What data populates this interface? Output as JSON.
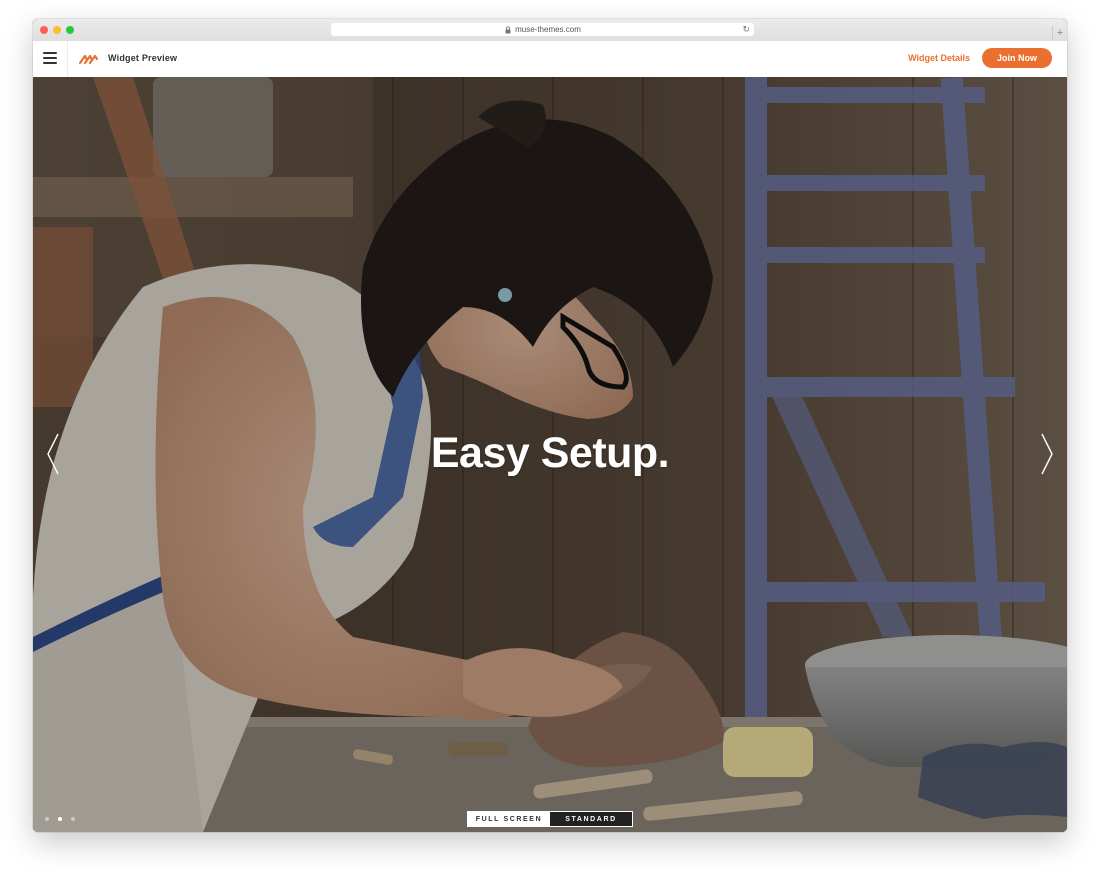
{
  "browser": {
    "url": "muse-themes.com"
  },
  "header": {
    "title": "Widget Preview",
    "details_link": "Widget Details",
    "join_button": "Join Now",
    "accent_color": "#e9702e"
  },
  "hero": {
    "headline": "Easy Setup.",
    "slides": {
      "count": 3,
      "active": 2
    }
  },
  "view_toggle": {
    "full_screen": "FULL SCREEN",
    "standard": "STANDARD",
    "selected": "FULL SCREEN"
  },
  "icons": {
    "menu": "hamburger-menu-icon",
    "logo": "brand-logo-icon",
    "lock": "lock-icon",
    "reload": "reload-icon",
    "prev": "chevron-left-icon",
    "next": "chevron-right-icon"
  }
}
